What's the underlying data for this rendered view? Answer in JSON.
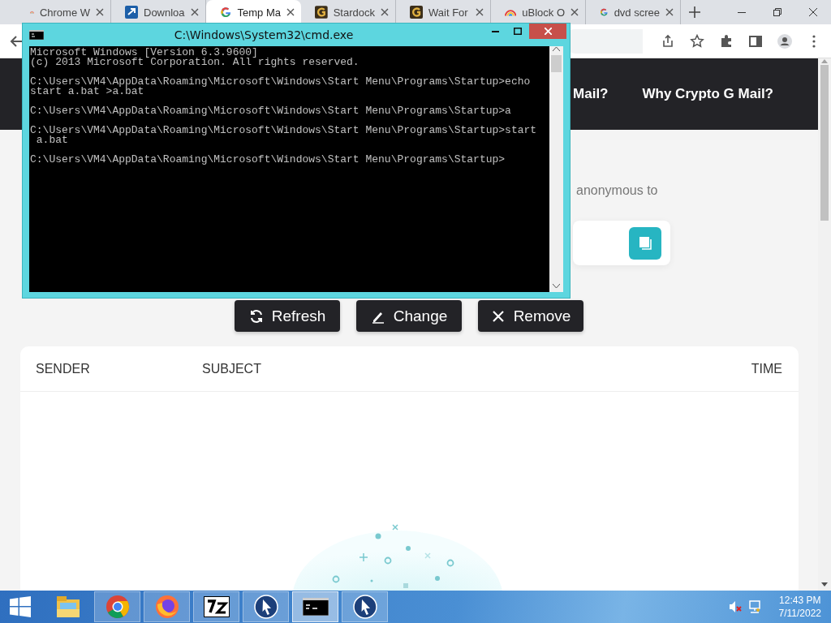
{
  "browser": {
    "tabs": [
      {
        "label": "Chrome W",
        "kind": "rainbow",
        "selected": false
      },
      {
        "label": "Downloa",
        "kind": "download",
        "selected": false
      },
      {
        "label": "Temp Ma",
        "kind": "google",
        "selected": true
      },
      {
        "label": "Stardock",
        "kind": "stardock",
        "selected": false
      },
      {
        "label": "Wait For",
        "kind": "stardock",
        "selected": false
      },
      {
        "label": "uBlock O",
        "kind": "rainbow",
        "selected": false
      },
      {
        "label": "dvd scree",
        "kind": "google",
        "selected": false
      }
    ]
  },
  "page": {
    "nav_links": [
      "Mail?",
      "Why Crypto G Mail?"
    ],
    "intro_text": "anonymous to",
    "buttons": [
      {
        "label": "Refresh",
        "kind": "refresh"
      },
      {
        "label": "Change",
        "kind": "edit"
      },
      {
        "label": "Remove",
        "kind": "remove"
      }
    ],
    "table": {
      "columns": [
        "SENDER",
        "SUBJECT",
        "TIME"
      ]
    }
  },
  "cmd_window": {
    "title": "C:\\Windows\\System32\\cmd.exe",
    "blocks": [
      [
        "Microsoft Windows [Version 6.3.9600]",
        "(c) 2013 Microsoft Corporation. All rights reserved."
      ],
      [
        "C:\\Users\\VM4\\AppData\\Roaming\\Microsoft\\Windows\\Start Menu\\Programs\\Startup>echo",
        "start a.bat >a.bat"
      ],
      [
        "C:\\Users\\VM4\\AppData\\Roaming\\Microsoft\\Windows\\Start Menu\\Programs\\Startup>a"
      ],
      [
        "C:\\Users\\VM4\\AppData\\Roaming\\Microsoft\\Windows\\Start Menu\\Programs\\Startup>start",
        " a.bat"
      ],
      [
        "C:\\Users\\VM4\\AppData\\Roaming\\Microsoft\\Windows\\Start Menu\\Programs\\Startup>"
      ]
    ]
  },
  "taskbar": {
    "apps": [
      {
        "kind": "explorer",
        "running": false,
        "selected": false
      },
      {
        "kind": "chrome",
        "running": true,
        "selected": false
      },
      {
        "kind": "firefox",
        "running": true,
        "selected": false
      },
      {
        "kind": "archiver",
        "running": true,
        "selected": false
      },
      {
        "kind": "cursor",
        "running": true,
        "selected": false
      },
      {
        "kind": "console",
        "running": true,
        "selected": true
      },
      {
        "kind": "cursor",
        "running": true,
        "selected": false
      }
    ],
    "clock": {
      "time": "12:43 PM",
      "date": "7/11/2022"
    }
  }
}
